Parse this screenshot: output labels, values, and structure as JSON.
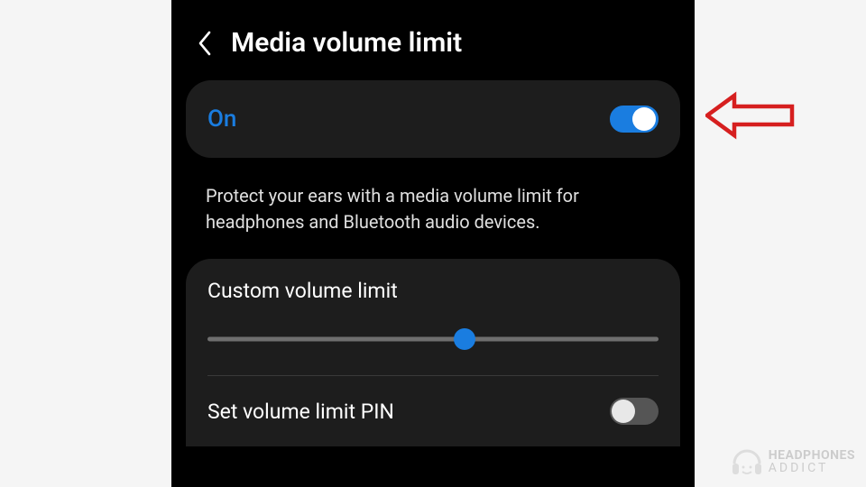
{
  "header": {
    "title": "Media volume limit"
  },
  "toggle": {
    "label": "On",
    "state": true
  },
  "description": "Protect your ears with a media volume limit for headphones and Bluetooth audio devices.",
  "custom": {
    "label": "Custom volume limit",
    "slider_value_pct": 57
  },
  "pin": {
    "label": "Set volume limit PIN",
    "state": false
  },
  "colors": {
    "accent": "#1a7de0",
    "card_bg": "#1d1d1d",
    "annotation_red": "#d61f1f"
  },
  "watermark": {
    "line1": "HEADPHONES",
    "line2": "ADDICT"
  }
}
